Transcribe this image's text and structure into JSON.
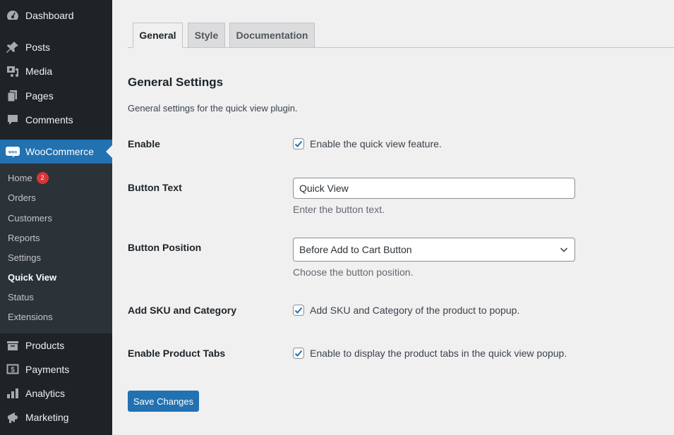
{
  "sidebar": {
    "items": [
      {
        "label": "Dashboard",
        "icon": "dashboard-icon"
      },
      {
        "label": "Posts",
        "icon": "pin-icon"
      },
      {
        "label": "Media",
        "icon": "media-icon"
      },
      {
        "label": "Pages",
        "icon": "pages-icon"
      },
      {
        "label": "Comments",
        "icon": "comment-icon"
      },
      {
        "label": "WooCommerce",
        "icon": "woo-icon"
      },
      {
        "label": "Products",
        "icon": "archive-icon"
      },
      {
        "label": "Payments",
        "icon": "dollar-icon"
      },
      {
        "label": "Analytics",
        "icon": "bar-chart-icon"
      },
      {
        "label": "Marketing",
        "icon": "megaphone-icon"
      }
    ],
    "submenu": [
      {
        "label": "Home",
        "badge": "2"
      },
      {
        "label": "Orders"
      },
      {
        "label": "Customers"
      },
      {
        "label": "Reports"
      },
      {
        "label": "Settings"
      },
      {
        "label": "Quick View"
      },
      {
        "label": "Status"
      },
      {
        "label": "Extensions"
      }
    ]
  },
  "tabs": [
    {
      "label": "General"
    },
    {
      "label": "Style"
    },
    {
      "label": "Documentation"
    }
  ],
  "main": {
    "title": "General Settings",
    "description": "General settings for the quick view plugin.",
    "fields": {
      "enable": {
        "label": "Enable",
        "checkbox_label": "Enable the quick view feature.",
        "checked": true
      },
      "button_text": {
        "label": "Button Text",
        "value": "Quick View",
        "hint": "Enter the button text."
      },
      "button_position": {
        "label": "Button Position",
        "selected": "Before Add to Cart Button",
        "hint": "Choose the button position."
      },
      "sku_category": {
        "label": "Add SKU and Category",
        "checkbox_label": "Add SKU and Category of the product to popup.",
        "checked": true
      },
      "product_tabs": {
        "label": "Enable Product Tabs",
        "checkbox_label": "Enable to display the product tabs in the quick view popup.",
        "checked": true
      }
    },
    "save_label": "Save Changes"
  },
  "colors": {
    "accent": "#2271b1",
    "sidebar_bg": "#1d2327",
    "submenu_bg": "#2c3338",
    "badge": "#d63638"
  }
}
